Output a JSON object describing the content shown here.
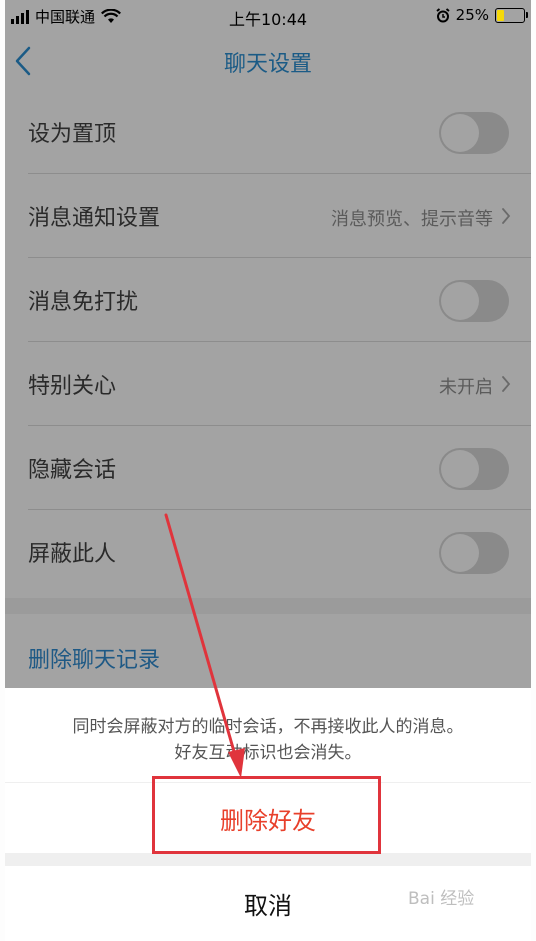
{
  "status_bar": {
    "carrier": "中国联通",
    "time": "上午10:44",
    "battery_percent": "25%",
    "battery_level": 0.25,
    "icons": [
      "signal-icon",
      "wifi-icon",
      "alarm-icon",
      "battery-icon"
    ]
  },
  "navbar": {
    "back_icon": "chevron-left-icon",
    "title": "聊天设置"
  },
  "settings": {
    "rows": [
      {
        "label": "设为置顶",
        "type": "toggle",
        "on": false
      },
      {
        "label": "消息通知设置",
        "type": "link",
        "value": "消息预览、提示音等"
      },
      {
        "label": "消息免打扰",
        "type": "toggle",
        "on": false
      },
      {
        "label": "特别关心",
        "type": "link",
        "value": "未开启"
      },
      {
        "label": "隐藏会话",
        "type": "toggle",
        "on": false
      },
      {
        "label": "屏蔽此人",
        "type": "toggle",
        "on": false
      }
    ],
    "clear_history": "删除聊天记录"
  },
  "action_sheet": {
    "message_line1": "同时会屏蔽对方的临时会话，不再接收此人的消息。",
    "message_line2": "好友互动标识也会消失。",
    "delete_label": "删除好友",
    "cancel_label": "取消"
  },
  "annotation": {
    "color": "#e0343c"
  },
  "watermark": {
    "text": "Bai 经验"
  },
  "colors": {
    "accent": "#1b5b86",
    "destructive": "#e8402b"
  }
}
